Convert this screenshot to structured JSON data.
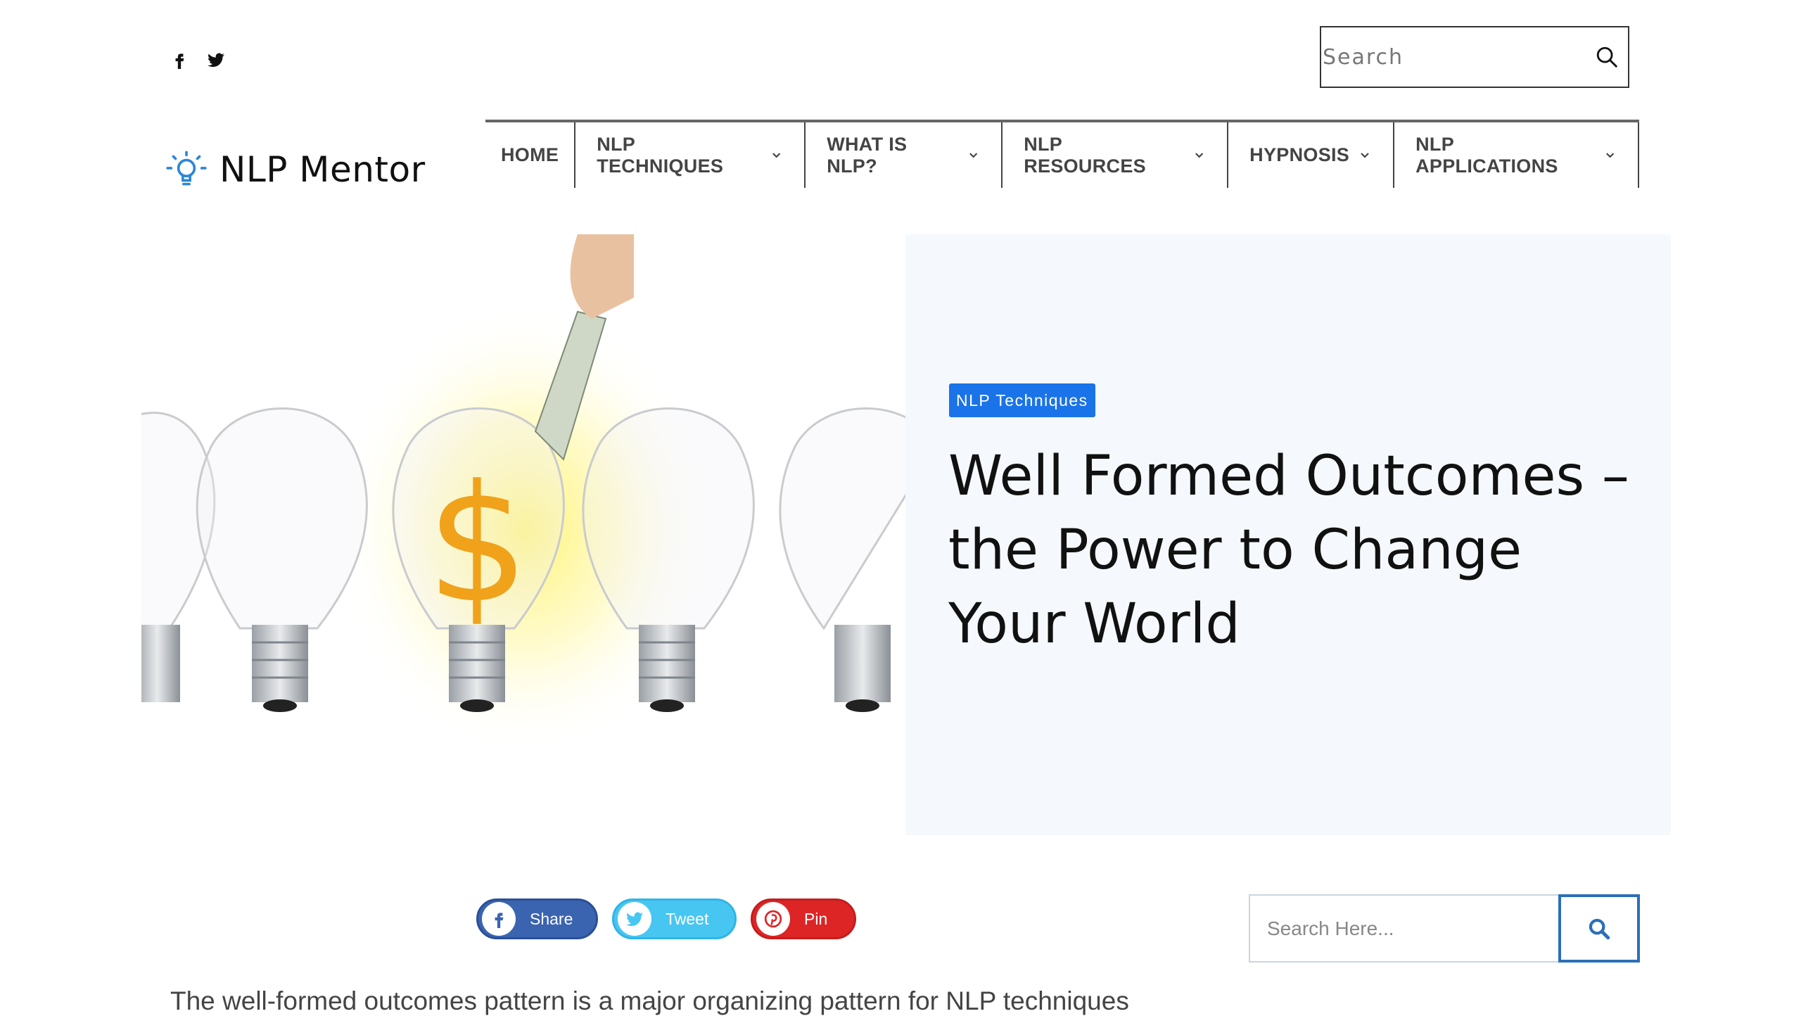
{
  "header": {
    "social": [
      {
        "name": "facebook-icon"
      },
      {
        "name": "twitter-icon"
      }
    ],
    "search_placeholder": "Search",
    "logo_text": "NLP Mentor"
  },
  "nav": {
    "items": [
      {
        "label": "HOME",
        "dropdown": false
      },
      {
        "label": "NLP TECHNIQUES",
        "dropdown": true
      },
      {
        "label": "WHAT IS NLP?",
        "dropdown": true
      },
      {
        "label": "NLP RESOURCES",
        "dropdown": true
      },
      {
        "label": "HYPNOSIS",
        "dropdown": true
      },
      {
        "label": "NLP APPLICATIONS",
        "dropdown": true
      }
    ]
  },
  "hero": {
    "category": "NLP Techniques",
    "title": "Well Formed Outcomes – the Power to Change Your World"
  },
  "share": {
    "facebook": "Share",
    "twitter": "Tweet",
    "pinterest": "Pin"
  },
  "sidebar": {
    "search_placeholder": "Search Here..."
  },
  "article": {
    "intro": "The well-formed outcomes pattern is a major organizing pattern for NLP techniques"
  },
  "colors": {
    "accent": "#1a73e8",
    "facebook": "#3b64b0",
    "twitter": "#48c6f2",
    "pinterest": "#dd2526",
    "hero_panel": "#f5f9fd"
  }
}
